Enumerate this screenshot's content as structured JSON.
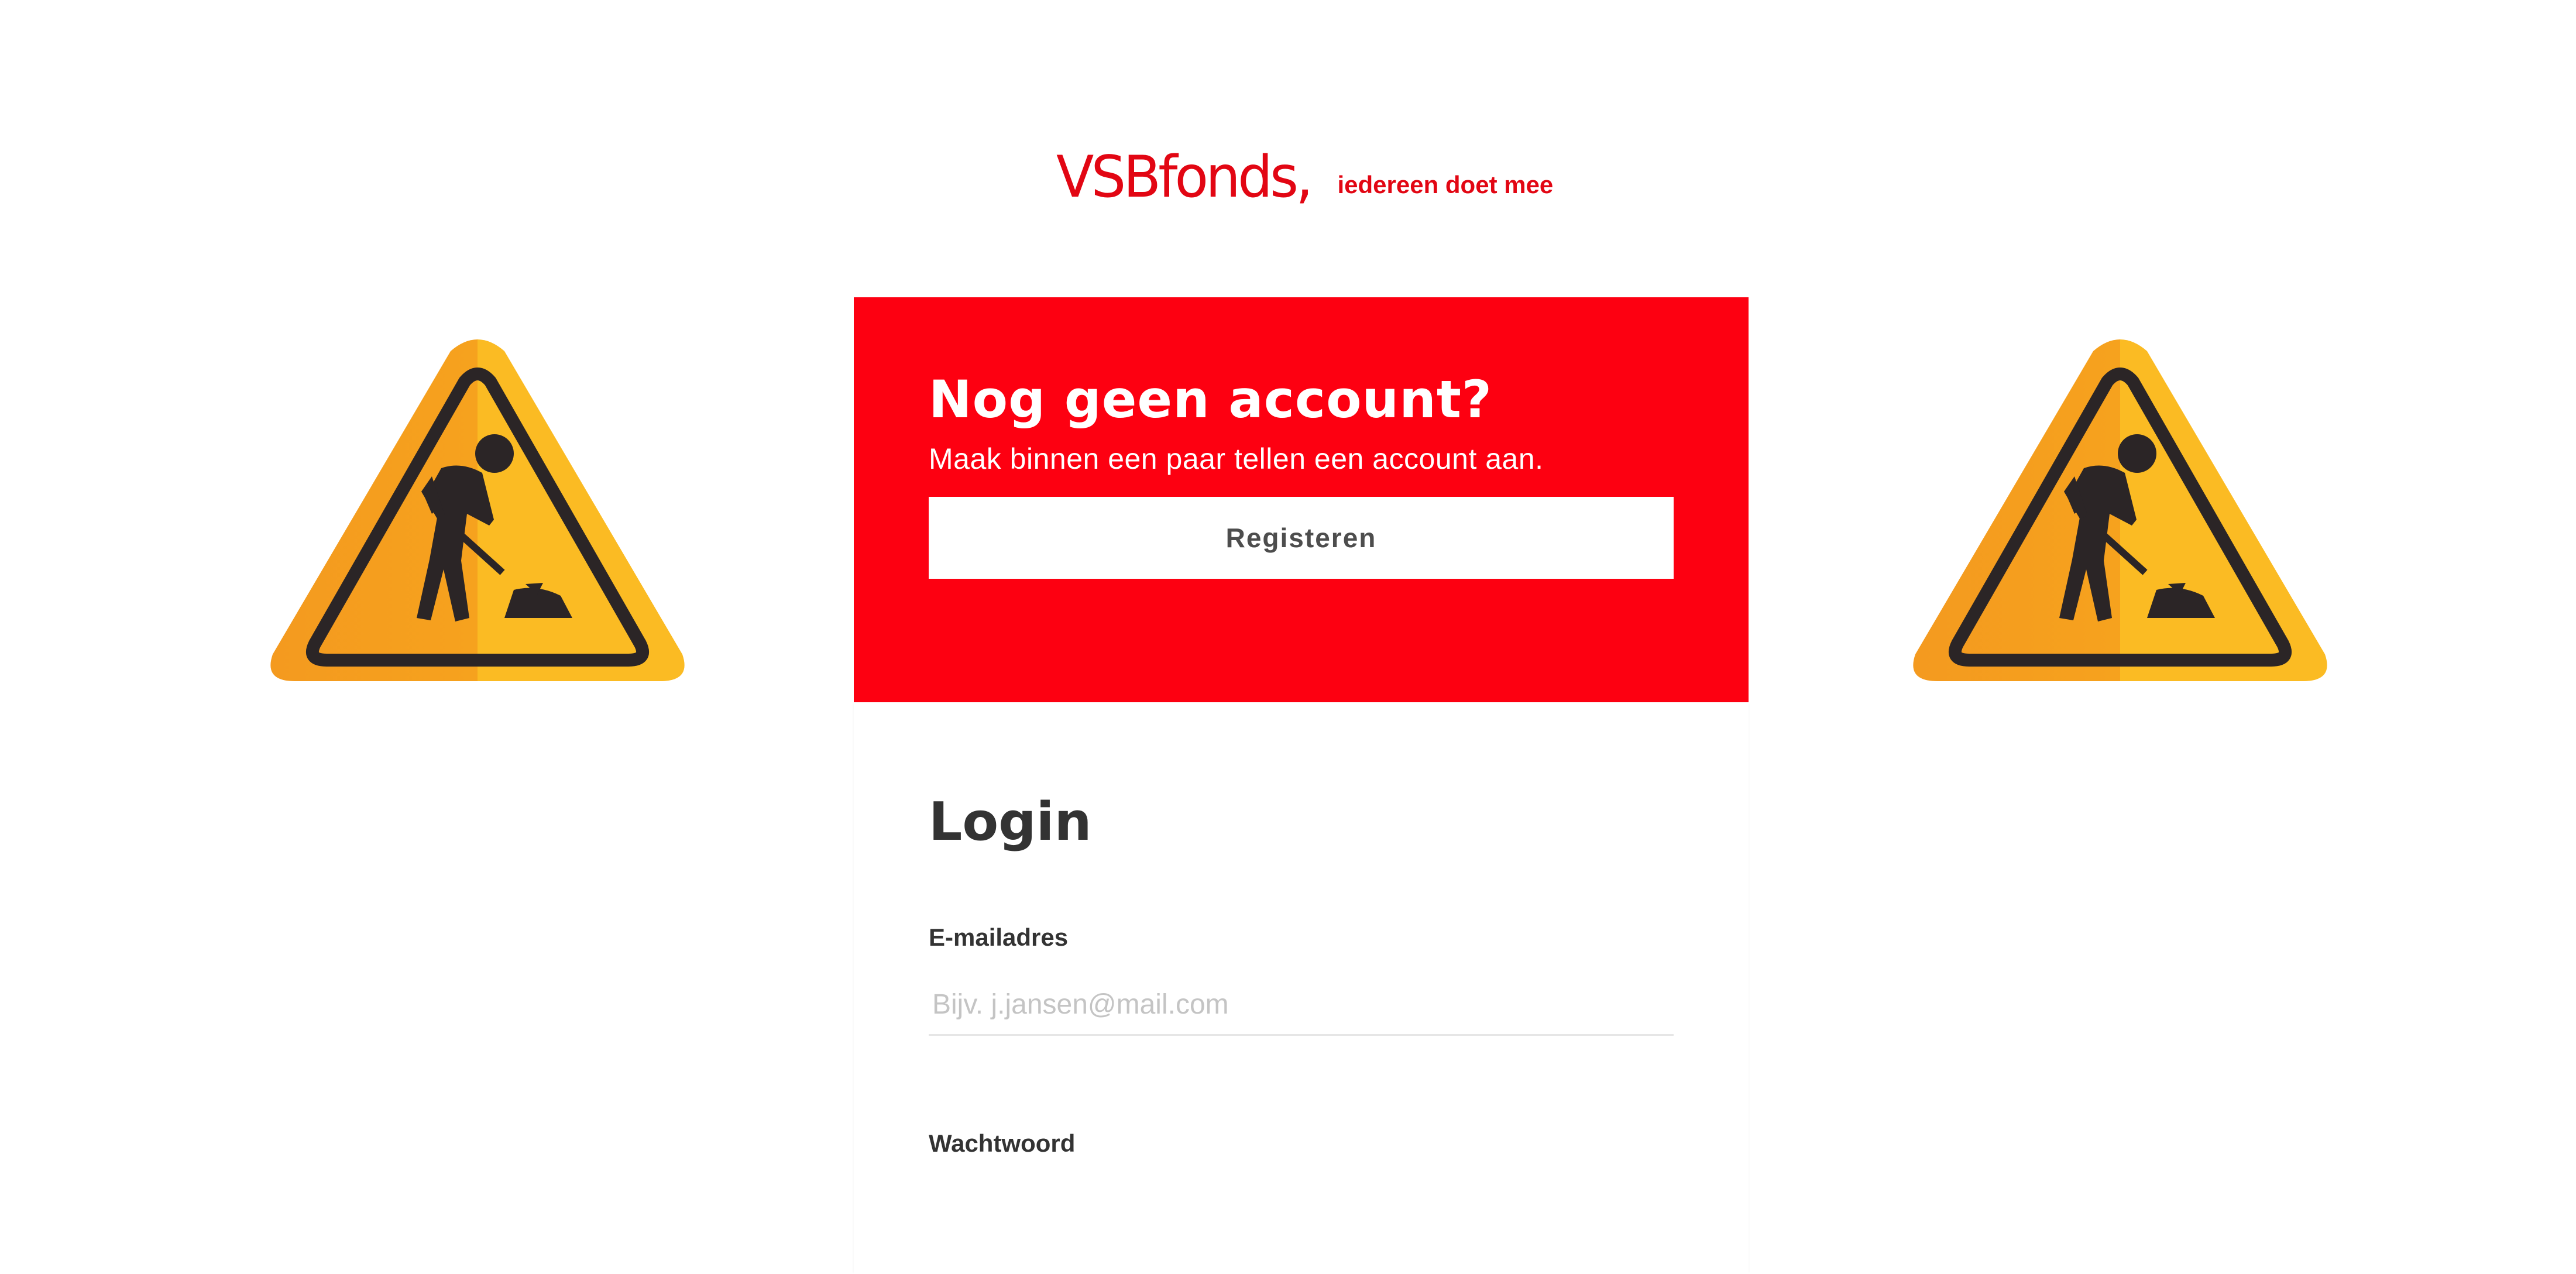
{
  "header": {
    "logo_text": "VSBfonds,",
    "tagline": "iedereen doet mee",
    "brand_color": "#e20613"
  },
  "register": {
    "heading": "Nog geen account?",
    "subtext": "Maak binnen een paar tellen een account aan.",
    "button_label": "Registeren",
    "background_color": "#fd0011"
  },
  "login": {
    "title": "Login",
    "email_label": "E-mailadres",
    "email_placeholder": "Bijv. j.jansen@mail.com",
    "email_value": "",
    "password_label": "Wachtwoord"
  },
  "decorations": {
    "left_sign_icon": "road-works-warning-icon",
    "right_sign_icon": "road-works-warning-icon",
    "sign_color": "#f6a21e"
  }
}
